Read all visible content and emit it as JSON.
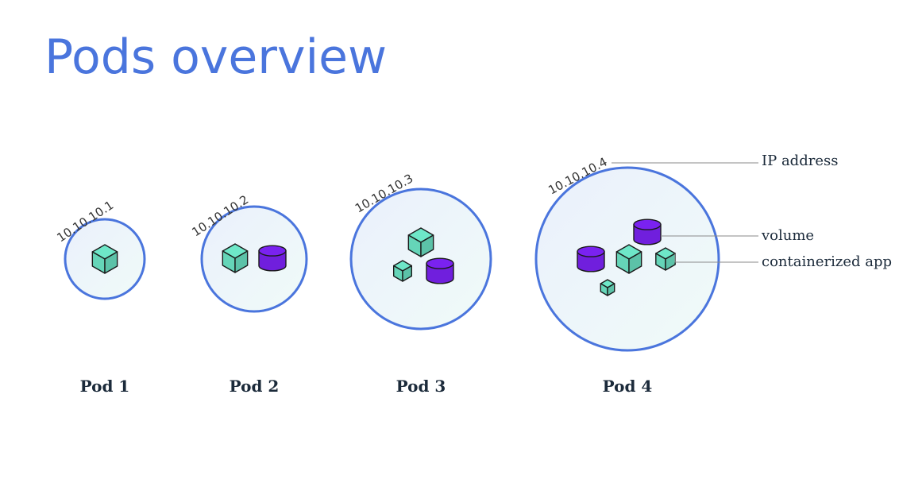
{
  "title": "Pods overview",
  "colors": {
    "title": "#4a75dd",
    "pod_border": "#4a75dd",
    "container": "#6ee7c8",
    "volume": "#7a22f0",
    "leader": "#8a8a8a"
  },
  "pods": [
    {
      "label": "Pod 1",
      "ip": "10.10.10.1",
      "containers": 1,
      "volumes": 0
    },
    {
      "label": "Pod 2",
      "ip": "10.10.10.2",
      "containers": 1,
      "volumes": 1
    },
    {
      "label": "Pod 3",
      "ip": "10.10.10.3",
      "containers": 2,
      "volumes": 1
    },
    {
      "label": "Pod 4",
      "ip": "10.10.10.4",
      "containers": 3,
      "volumes": 2
    }
  ],
  "legend": {
    "ip_address": "IP address",
    "volume": "volume",
    "containerized_app": "containerized app"
  },
  "icons": {
    "container": "cube-icon",
    "volume": "cylinder-icon"
  }
}
